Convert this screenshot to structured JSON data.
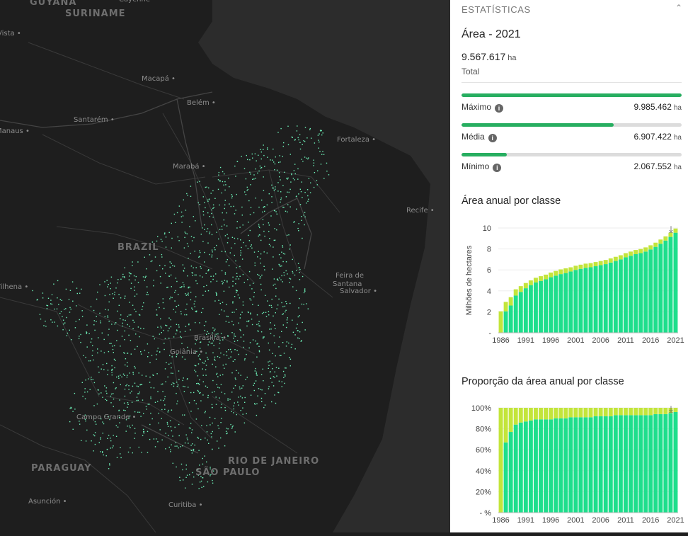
{
  "map": {
    "labels": [
      {
        "text": "GUYANA",
        "kind": "country"
      },
      {
        "text": "SURINAME",
        "kind": "country"
      },
      {
        "text": "Cayenne",
        "kind": "city"
      },
      {
        "text": "Vista",
        "kind": "city"
      },
      {
        "text": "Macapá",
        "kind": "city"
      },
      {
        "text": "Belém",
        "kind": "city"
      },
      {
        "text": "Manaus",
        "kind": "city"
      },
      {
        "text": "Santarém",
        "kind": "city"
      },
      {
        "text": "Fortaleza",
        "kind": "city"
      },
      {
        "text": "Marabá",
        "kind": "city"
      },
      {
        "text": "Recife",
        "kind": "city"
      },
      {
        "text": "BRAZIL",
        "kind": "country"
      },
      {
        "text": "Feira de",
        "kind": "place"
      },
      {
        "text": "Santana",
        "kind": "place"
      },
      {
        "text": "Salvador",
        "kind": "city"
      },
      {
        "text": "Vilhena",
        "kind": "city"
      },
      {
        "text": "Brasília",
        "kind": "city"
      },
      {
        "text": "Goiânia",
        "kind": "city"
      },
      {
        "text": "Campo Grande",
        "kind": "city"
      },
      {
        "text": "RIO DE JANEIRO",
        "kind": "country"
      },
      {
        "text": "SÃO PAULO",
        "kind": "country"
      },
      {
        "text": "PARAGUAY",
        "kind": "country"
      },
      {
        "text": "Asunción",
        "kind": "city"
      },
      {
        "text": "Curitiba",
        "kind": "city"
      }
    ]
  },
  "panel": {
    "title": "ESTATÍSTICAS",
    "collapse_icon": "chevron-up-icon",
    "area_title": "Área - 2021",
    "total_value": "9.567.617",
    "unit": "ha",
    "total_label": "Total",
    "stats": [
      {
        "label": "Máximo",
        "value": "9.985.462",
        "unit": "ha",
        "fraction": 1.0
      },
      {
        "label": "Média",
        "value": "6.907.422",
        "unit": "ha",
        "fraction": 0.692
      },
      {
        "label": "Mínimo",
        "value": "2.067.552",
        "unit": "ha",
        "fraction": 0.207
      }
    ],
    "info_icon": "info-icon"
  },
  "colors": {
    "green_bar": "#27ae60",
    "series_teal": "#1ede8c",
    "series_lime": "#c3e53b",
    "map_dots": "#6ef2b9",
    "map_bg": "#1e1e1e"
  },
  "chart_data": [
    {
      "type": "bar",
      "stacked": true,
      "title": "Área anual por classe",
      "ylabel": "Milhões de hectares",
      "ylim": [
        0,
        10
      ],
      "yticks": [
        "-",
        "2",
        "4",
        "6",
        "8",
        "10"
      ],
      "xtick_labels": [
        "1986",
        "1991",
        "1996",
        "2001",
        "2006",
        "2011",
        "2016",
        "2021"
      ],
      "categories": [
        "1986",
        "1987",
        "1988",
        "1989",
        "1990",
        "1991",
        "1992",
        "1993",
        "1994",
        "1995",
        "1996",
        "1997",
        "1998",
        "1999",
        "2000",
        "2001",
        "2002",
        "2003",
        "2004",
        "2005",
        "2006",
        "2007",
        "2008",
        "2009",
        "2010",
        "2011",
        "2012",
        "2013",
        "2014",
        "2015",
        "2016",
        "2017",
        "2018",
        "2019",
        "2020",
        "2021"
      ],
      "series": [
        {
          "values": [
            0.0,
            2.05,
            2.6,
            3.55,
            3.9,
            4.25,
            4.55,
            4.8,
            4.95,
            5.1,
            5.3,
            5.45,
            5.6,
            5.7,
            5.85,
            6.0,
            6.1,
            6.2,
            6.25,
            6.35,
            6.45,
            6.55,
            6.7,
            6.85,
            7.0,
            7.2,
            7.35,
            7.5,
            7.6,
            7.75,
            7.95,
            8.2,
            8.5,
            8.8,
            9.15,
            9.55
          ]
        },
        {
          "values": [
            2.05,
            0.9,
            0.8,
            0.6,
            0.55,
            0.5,
            0.45,
            0.45,
            0.45,
            0.45,
            0.45,
            0.45,
            0.45,
            0.45,
            0.4,
            0.4,
            0.4,
            0.4,
            0.4,
            0.4,
            0.4,
            0.4,
            0.4,
            0.4,
            0.4,
            0.4,
            0.4,
            0.4,
            0.4,
            0.4,
            0.4,
            0.4,
            0.4,
            0.4,
            0.4,
            0.4
          ]
        }
      ]
    },
    {
      "type": "bar",
      "stacked": true,
      "title": "Proporção da área anual por classe",
      "ylim": [
        0,
        100
      ],
      "yticks": [
        "- %",
        "20%",
        "40%",
        "60%",
        "80%",
        "100%"
      ],
      "xtick_labels": [
        "1986",
        "1991",
        "1996",
        "2001",
        "2006",
        "2011",
        "2016",
        "2021"
      ],
      "categories": [
        "1986",
        "1987",
        "1988",
        "1989",
        "1990",
        "1991",
        "1992",
        "1993",
        "1994",
        "1995",
        "1996",
        "1997",
        "1998",
        "1999",
        "2000",
        "2001",
        "2002",
        "2003",
        "2004",
        "2005",
        "2006",
        "2007",
        "2008",
        "2009",
        "2010",
        "2011",
        "2012",
        "2013",
        "2014",
        "2015",
        "2016",
        "2017",
        "2018",
        "2019",
        "2020",
        "2021"
      ],
      "series": [
        {
          "values": [
            0,
            67,
            77,
            84,
            86,
            87,
            88,
            89,
            89,
            89,
            89,
            90,
            90,
            90,
            91,
            91,
            91,
            91,
            91,
            92,
            92,
            92,
            92,
            93,
            93,
            93,
            93,
            93,
            93,
            93,
            93,
            94,
            94,
            94,
            95,
            96
          ]
        },
        {
          "values": [
            100,
            33,
            23,
            16,
            14,
            13,
            12,
            11,
            11,
            11,
            11,
            10,
            10,
            10,
            9,
            9,
            9,
            9,
            9,
            8,
            8,
            8,
            8,
            7,
            7,
            7,
            7,
            7,
            7,
            7,
            7,
            6,
            6,
            6,
            5,
            4
          ]
        }
      ]
    }
  ]
}
